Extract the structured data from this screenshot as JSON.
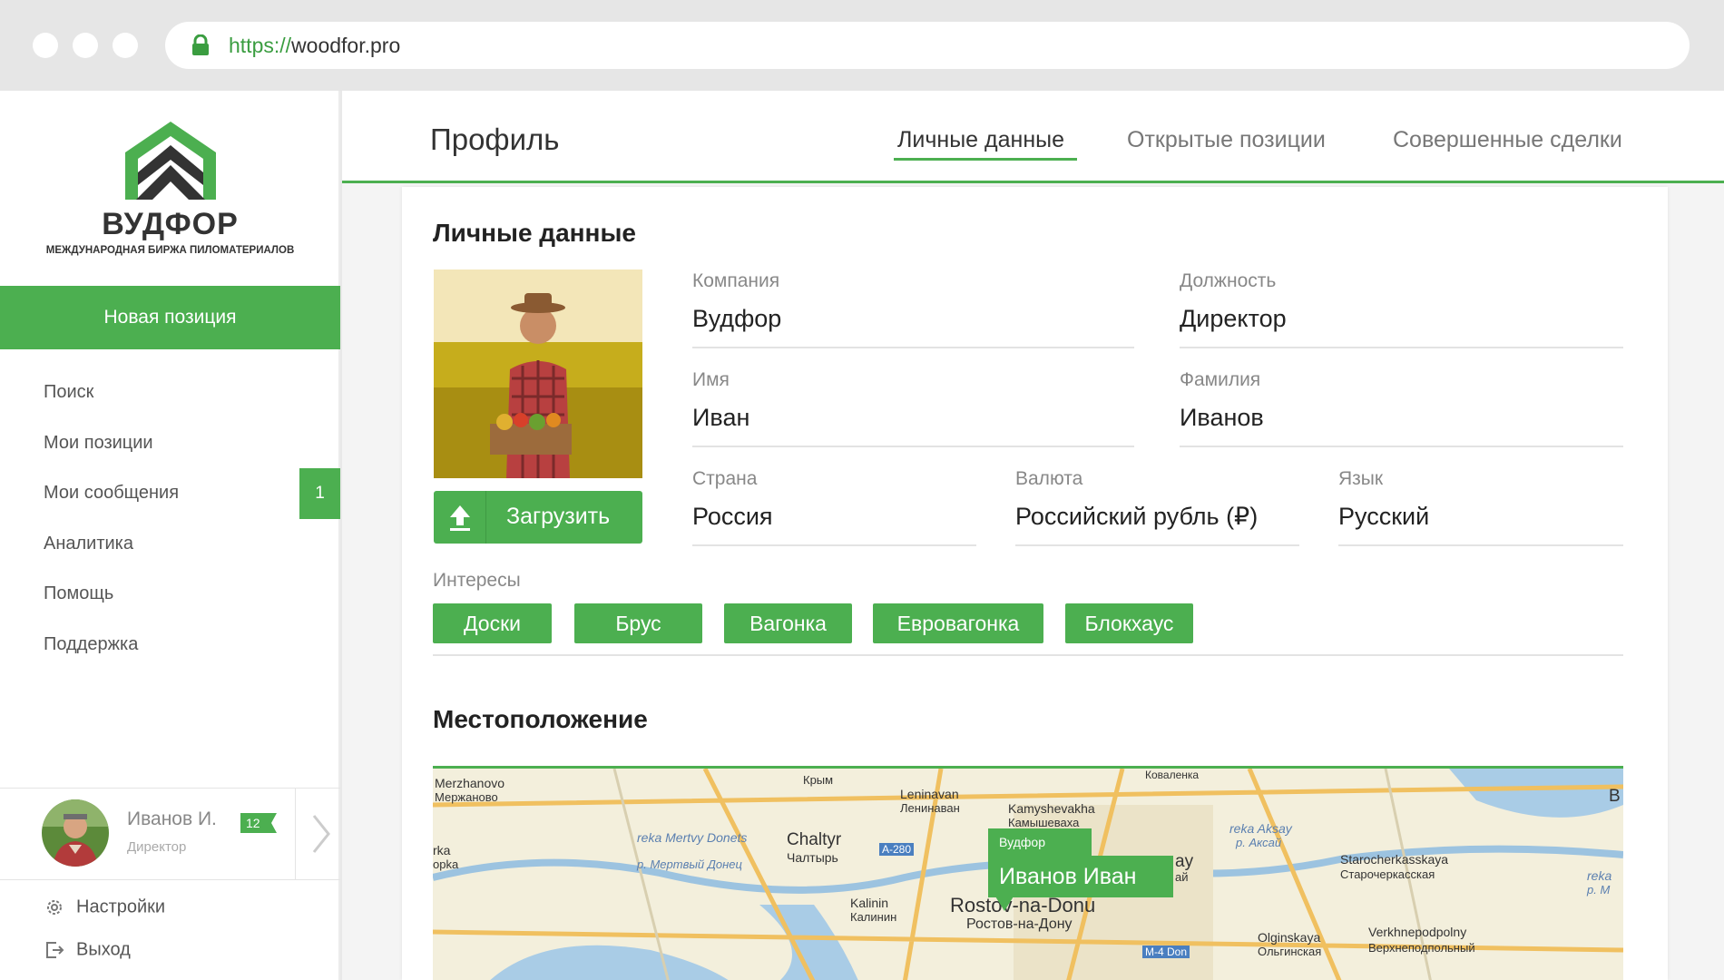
{
  "browser": {
    "url_scheme": "https://",
    "url_host": "woodfor.pro"
  },
  "brand": {
    "name": "ВУДФОР",
    "tagline": "МЕЖДУНАРОДНАЯ БИРЖА ПИЛОМАТЕРИАЛОВ",
    "accent": "#4caf50"
  },
  "sidebar": {
    "new_position": "Новая позиция",
    "items": [
      {
        "label": "Поиск"
      },
      {
        "label": "Мои позиции"
      },
      {
        "label": "Мои сообщения",
        "badge": "1"
      },
      {
        "label": "Аналитика"
      },
      {
        "label": "Помощь"
      },
      {
        "label": "Поддержка"
      }
    ],
    "user": {
      "name": "Иванов И.",
      "role": "Директор",
      "badge": "12"
    },
    "settings": "Настройки",
    "logout": "Выход"
  },
  "header": {
    "title": "Профиль",
    "tabs": [
      {
        "label": "Личные данные",
        "active": true
      },
      {
        "label": "Открытые позиции",
        "active": false
      },
      {
        "label": "Совершенные сделки",
        "active": false
      }
    ]
  },
  "profile": {
    "section_title": "Личные данные",
    "upload_label": "Загрузить",
    "fields": {
      "company": {
        "label": "Компания",
        "value": "Вудфор"
      },
      "position": {
        "label": "Должность",
        "value": "Директор"
      },
      "first_name": {
        "label": "Имя",
        "value": "Иван"
      },
      "last_name": {
        "label": "Фамилия",
        "value": "Иванов"
      },
      "country": {
        "label": "Страна",
        "value": "Россия"
      },
      "currency": {
        "label": "Валюта",
        "value": "Российский рубль (₽)"
      },
      "language": {
        "label": "Язык",
        "value": "Русский"
      }
    },
    "interests_label": "Интересы",
    "interests": [
      "Доски",
      "Брус",
      "Вагонка",
      "Евровагонка",
      "Блокхаус"
    ]
  },
  "location": {
    "section_title": "Местоположение",
    "marker_company": "Вудфор",
    "marker_name": "Иванов Иван",
    "map_labels": [
      "Merzhanovo",
      "Мержаново",
      "Крым",
      "Leninavan",
      "Ленинаван",
      "Kamyshevakha",
      "Камышеваха",
      "Коваленка",
      "reka Mertvy Donets",
      "р. Мертвый Донец",
      "Chaltyr",
      "Чалтырь",
      "A-280",
      "reka Aksay",
      "р. Аксай",
      "Starocherkasskaya",
      "Старочеркасская",
      "Kalinin",
      "Калинин",
      "Rostov-na-Donu",
      "Ростов-на-Дону",
      "M-4 Don",
      "Olginskaya",
      "Ольгинская",
      "Verkhnepodpolny",
      "Верхнеподпольный",
      "rka",
      "opka",
      "ay",
      "ай",
      "B",
      "reka",
      "р. М"
    ]
  }
}
